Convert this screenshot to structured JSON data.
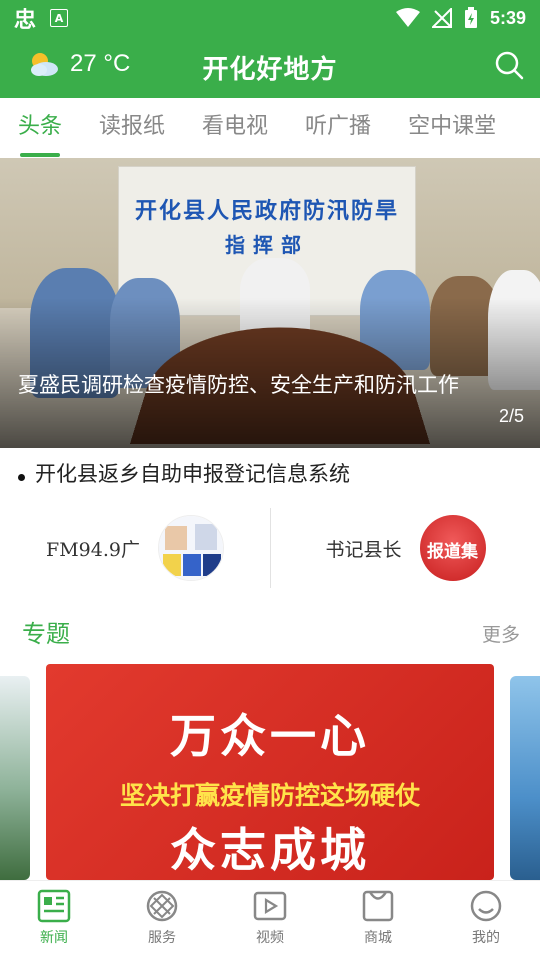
{
  "status_bar": {
    "time": "5:39",
    "app_glyph": "忠",
    "notification_letter": "A"
  },
  "header": {
    "temperature": "27 °C",
    "title": "开化好地方",
    "weather_icon": "partly-cloudy-icon",
    "search_icon": "search-icon"
  },
  "tabs": [
    {
      "label": "头条",
      "active": true
    },
    {
      "label": "读报纸",
      "active": false
    },
    {
      "label": "看电视",
      "active": false
    },
    {
      "label": "听广播",
      "active": false
    },
    {
      "label": "空中课堂",
      "active": false
    }
  ],
  "banner": {
    "sign_line1": "开化县人民政府防汛防旱",
    "sign_line2": "指挥部",
    "caption": "夏盛民调研检查疫情防控、安全生产和防汛工作",
    "counter": "2/5"
  },
  "headline_link": "开化县返乡自助申报登记信息系统",
  "feature_cards": [
    {
      "label": "FM94.9广",
      "thumb_text": ""
    },
    {
      "label": "书记县长",
      "thumb_text": "报道集"
    }
  ],
  "section": {
    "title": "专题",
    "more": "更多"
  },
  "topic_banner": {
    "line1": "万众一心",
    "line2": "坚决打赢疫情防控这场硬仗",
    "line3": "众志成城"
  },
  "bottom_nav": [
    {
      "label": "新闻",
      "icon": "news-icon",
      "active": true
    },
    {
      "label": "服务",
      "icon": "service-icon",
      "active": false
    },
    {
      "label": "视频",
      "icon": "video-icon",
      "active": false
    },
    {
      "label": "商城",
      "icon": "shop-icon",
      "active": false
    },
    {
      "label": "我的",
      "icon": "profile-icon",
      "active": false
    }
  ],
  "colors": {
    "brand_green": "#3aae4a",
    "topic_red": "#d62a22",
    "slogan_yellow": "#ffe34a"
  }
}
